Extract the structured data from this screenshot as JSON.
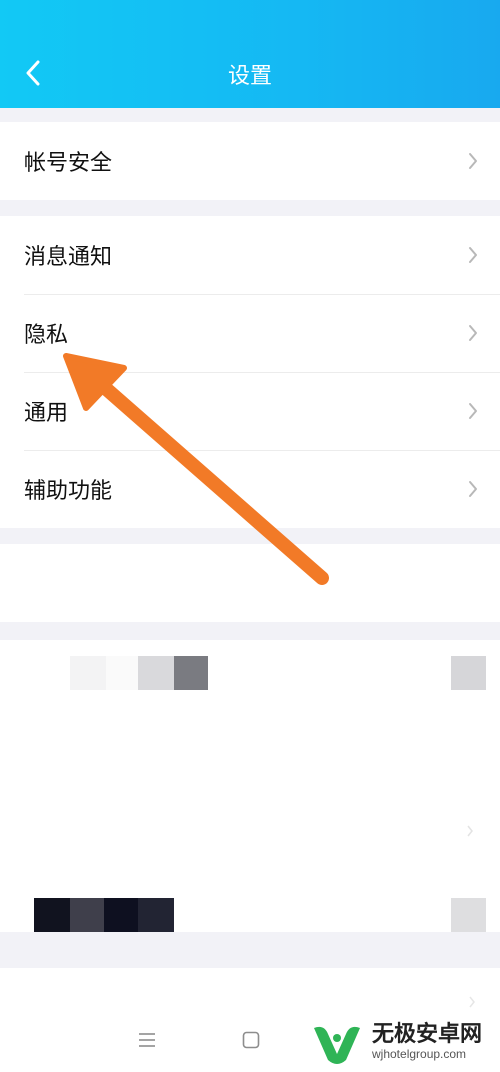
{
  "header": {
    "title": "设置",
    "back_icon": "chevron-left-icon"
  },
  "groups": [
    {
      "items": [
        {
          "label": "帐号安全"
        }
      ]
    },
    {
      "items": [
        {
          "label": "消息通知"
        },
        {
          "label": "隐私"
        },
        {
          "label": "通用"
        },
        {
          "label": "辅助功能"
        }
      ]
    }
  ],
  "annotation": {
    "arrow_color": "#f27a27"
  },
  "navbar": {
    "menu_icon": "menu-icon",
    "home_icon": "home-square-icon"
  },
  "watermark": {
    "name": "无极安卓网",
    "url": "wjhotelgroup.com",
    "logo_color": "#2fb456"
  },
  "colors": {
    "header": "#15b8f3",
    "background": "#f2f2f7"
  }
}
